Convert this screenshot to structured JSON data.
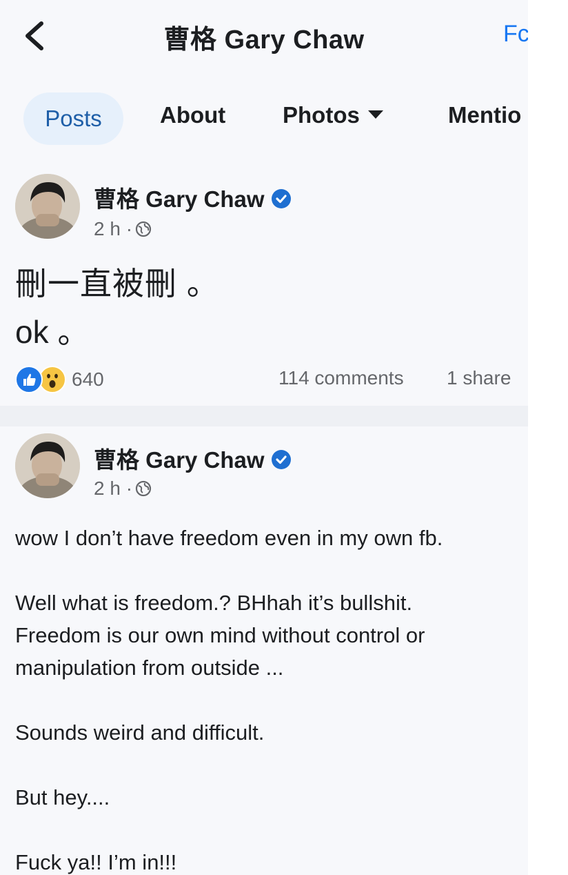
{
  "header": {
    "title": "曹格 Gary Chaw",
    "follow_label": "Fc"
  },
  "tabs": [
    {
      "label": "Posts"
    },
    {
      "label": "About"
    },
    {
      "label": "Photos"
    },
    {
      "label": "Mentio"
    }
  ],
  "colors": {
    "accent": "#1877f2",
    "active_tab_bg": "#e6f0fb",
    "secondary_text": "#65676b"
  },
  "posts": [
    {
      "author": "曹格 Gary Chaw",
      "time": "2 h ·",
      "text_lines": [
        "刪一直被刪 。",
        "ok 。"
      ],
      "reaction_icons": [
        "like-icon",
        "wow-icon"
      ],
      "reaction_count": "640",
      "comments": "114 comments",
      "shares": "1 share"
    },
    {
      "author": "曹格 Gary Chaw",
      "time": "2 h ·",
      "paragraphs": [
        "wow I don’t have freedom even in my own fb.",
        "Well what is freedom.? BHhah it’s bullshit.",
        "Freedom is our own mind without control or",
        "manipulation from outside ...",
        "Sounds weird and difficult.",
        "But hey....",
        "Fuck ya!! I’m in!!!"
      ]
    }
  ]
}
